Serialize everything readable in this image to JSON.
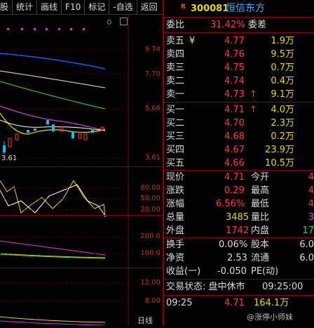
{
  "toolbar": {
    "items": [
      "股",
      "统计",
      "画线",
      "F10",
      "标记",
      "-自选",
      "返回"
    ]
  },
  "chart": {
    "price_axis": [
      "9.74",
      "7.70",
      "5.66",
      "3.61"
    ],
    "low_label": "3.61",
    "vol_axis": [
      "80.00",
      "50.00",
      "20.00"
    ],
    "ind2_axis": [
      "200.0",
      "100.0"
    ],
    "ind3_axis": [
      "12.00",
      "8.00"
    ],
    "bottom_right_label": "日线"
  },
  "stock": {
    "badge": "R",
    "code": "300081",
    "name": "恒信东方"
  },
  "ratio": {
    "label1": "委比",
    "value1": "31.42%",
    "label2": "委差"
  },
  "asks": [
    {
      "label": "卖五",
      "mark": "¥",
      "price": "4.77",
      "vol": "1.9万"
    },
    {
      "label": "卖四",
      "mark": "",
      "price": "4.76",
      "vol": "9.5万"
    },
    {
      "label": "卖三",
      "mark": "",
      "price": "4.75",
      "vol": "0.7万"
    },
    {
      "label": "卖二",
      "mark": "",
      "price": "4.74",
      "vol": "0.4万"
    },
    {
      "label": "卖一",
      "mark": "",
      "price": "4.73",
      "arrow": "↑",
      "vol": "9.1万"
    }
  ],
  "bids": [
    {
      "label": "买一",
      "price": "4.71",
      "arrow": "↑",
      "vol": "4.0万"
    },
    {
      "label": "买二",
      "price": "4.70",
      "arrow": "",
      "vol": "2.3万"
    },
    {
      "label": "买三",
      "price": "4.68",
      "arrow": "",
      "vol": "0.2万"
    },
    {
      "label": "买四",
      "price": "4.67",
      "arrow": "",
      "vol": "23.9万"
    },
    {
      "label": "买五",
      "price": "4.66",
      "arrow": "",
      "vol": "10.5万"
    }
  ],
  "quote": [
    {
      "l1": "现价",
      "v1": "4.71",
      "l2": "今开",
      "v2": "4"
    },
    {
      "l1": "涨跌",
      "v1": "0.29",
      "l2": "最高",
      "v2": "4"
    },
    {
      "l1": "涨幅",
      "v1": "6.56%",
      "l2": "最低",
      "v2": "4"
    },
    {
      "l1": "总量",
      "v1": "3485",
      "l2": "量比",
      "v2": "3"
    },
    {
      "l1": "外盘",
      "v1": "1742",
      "l2": "内盘",
      "v2": "17"
    }
  ],
  "fund": [
    {
      "l1": "换手",
      "v1": "0.06%",
      "l2": "股本",
      "v2": "6.0"
    },
    {
      "l1": "净资",
      "v1": "2.53",
      "l2": "流通",
      "v2": "6.0"
    },
    {
      "l1": "收益(一)",
      "v1": "-0.050",
      "l2": "PE(动)",
      "v2": ""
    }
  ],
  "status": {
    "label": "交易状态: 盘中休市",
    "time": "09:25:00"
  },
  "tick": {
    "time": "09:25",
    "price": "4.71",
    "vol": "164.1万"
  },
  "watermark": "@涨停小师妹"
}
